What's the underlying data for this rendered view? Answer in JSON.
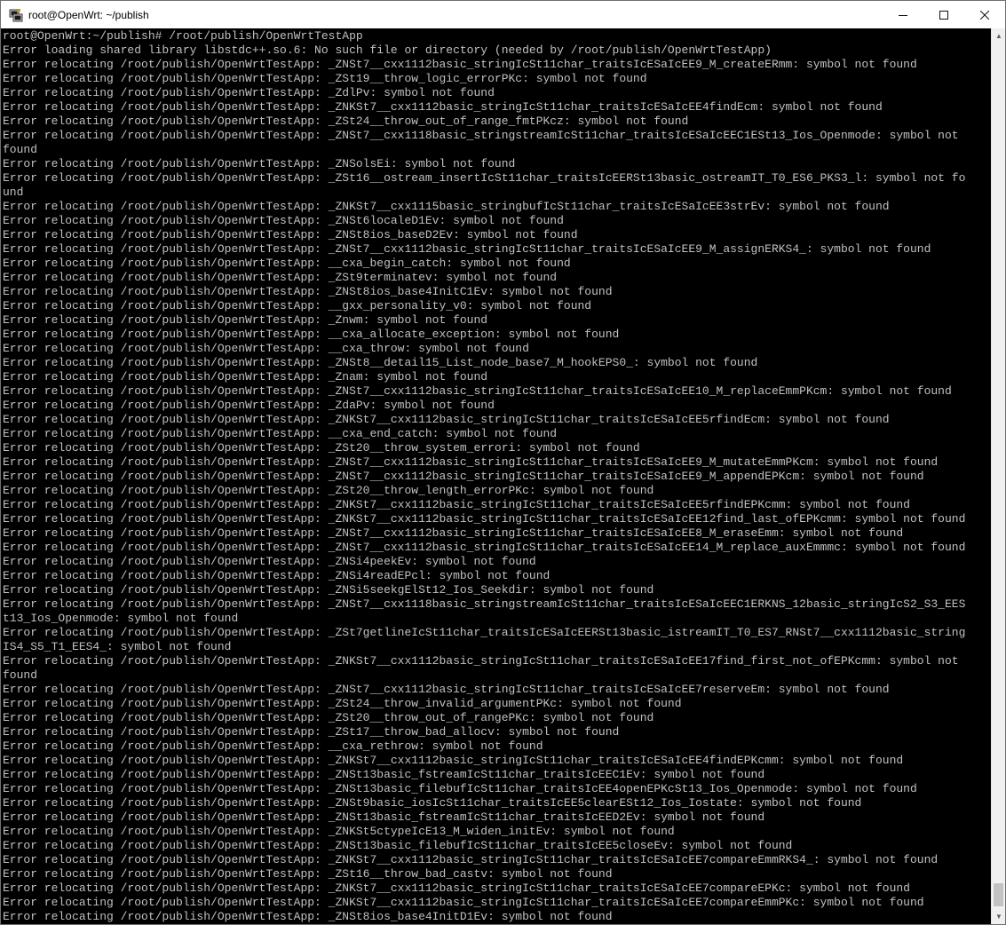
{
  "window": {
    "title": "root@OpenWrt: ~/publish",
    "app_icon": "putty-icon",
    "minimize_icon": "minimize-icon",
    "maximize_icon": "maximize-icon",
    "close_icon": "close-icon"
  },
  "terminal": {
    "background": "#000000",
    "foreground": "#c0c0c0",
    "lines": [
      "root@OpenWrt:~/publish# /root/publish/OpenWrtTestApp",
      "Error loading shared library libstdc++.so.6: No such file or directory (needed by /root/publish/OpenWrtTestApp)",
      "Error relocating /root/publish/OpenWrtTestApp: _ZNSt7__cxx1112basic_stringIcSt11char_traitsIcESaIcEE9_M_createERmm: symbol not found",
      "Error relocating /root/publish/OpenWrtTestApp: _ZSt19__throw_logic_errorPKc: symbol not found",
      "Error relocating /root/publish/OpenWrtTestApp: _ZdlPv: symbol not found",
      "Error relocating /root/publish/OpenWrtTestApp: _ZNKSt7__cxx1112basic_stringIcSt11char_traitsIcESaIcEE4findEcm: symbol not found",
      "Error relocating /root/publish/OpenWrtTestApp: _ZSt24__throw_out_of_range_fmtPKcz: symbol not found",
      "Error relocating /root/publish/OpenWrtTestApp: _ZNSt7__cxx1118basic_stringstreamIcSt11char_traitsIcESaIcEEC1ESt13_Ios_Openmode: symbol not",
      "found",
      "Error relocating /root/publish/OpenWrtTestApp: _ZNSolsEi: symbol not found",
      "Error relocating /root/publish/OpenWrtTestApp: _ZSt16__ostream_insertIcSt11char_traitsIcEERSt13basic_ostreamIT_T0_ES6_PKS3_l: symbol not fo",
      "und",
      "Error relocating /root/publish/OpenWrtTestApp: _ZNKSt7__cxx1115basic_stringbufIcSt11char_traitsIcESaIcEE3strEv: symbol not found",
      "Error relocating /root/publish/OpenWrtTestApp: _ZNSt6localeD1Ev: symbol not found",
      "Error relocating /root/publish/OpenWrtTestApp: _ZNSt8ios_baseD2Ev: symbol not found",
      "Error relocating /root/publish/OpenWrtTestApp: _ZNSt7__cxx1112basic_stringIcSt11char_traitsIcESaIcEE9_M_assignERKS4_: symbol not found",
      "Error relocating /root/publish/OpenWrtTestApp: __cxa_begin_catch: symbol not found",
      "Error relocating /root/publish/OpenWrtTestApp: _ZSt9terminatev: symbol not found",
      "Error relocating /root/publish/OpenWrtTestApp: _ZNSt8ios_base4InitC1Ev: symbol not found",
      "Error relocating /root/publish/OpenWrtTestApp: __gxx_personality_v0: symbol not found",
      "Error relocating /root/publish/OpenWrtTestApp: _Znwm: symbol not found",
      "Error relocating /root/publish/OpenWrtTestApp: __cxa_allocate_exception: symbol not found",
      "Error relocating /root/publish/OpenWrtTestApp: __cxa_throw: symbol not found",
      "Error relocating /root/publish/OpenWrtTestApp: _ZNSt8__detail15_List_node_base7_M_hookEPS0_: symbol not found",
      "Error relocating /root/publish/OpenWrtTestApp: _Znam: symbol not found",
      "Error relocating /root/publish/OpenWrtTestApp: _ZNSt7__cxx1112basic_stringIcSt11char_traitsIcESaIcEE10_M_replaceEmmPKcm: symbol not found",
      "Error relocating /root/publish/OpenWrtTestApp: _ZdaPv: symbol not found",
      "Error relocating /root/publish/OpenWrtTestApp: _ZNKSt7__cxx1112basic_stringIcSt11char_traitsIcESaIcEE5rfindEcm: symbol not found",
      "Error relocating /root/publish/OpenWrtTestApp: __cxa_end_catch: symbol not found",
      "Error relocating /root/publish/OpenWrtTestApp: _ZSt20__throw_system_errori: symbol not found",
      "Error relocating /root/publish/OpenWrtTestApp: _ZNSt7__cxx1112basic_stringIcSt11char_traitsIcESaIcEE9_M_mutateEmmPKcm: symbol not found",
      "Error relocating /root/publish/OpenWrtTestApp: _ZNSt7__cxx1112basic_stringIcSt11char_traitsIcESaIcEE9_M_appendEPKcm: symbol not found",
      "Error relocating /root/publish/OpenWrtTestApp: _ZSt20__throw_length_errorPKc: symbol not found",
      "Error relocating /root/publish/OpenWrtTestApp: _ZNKSt7__cxx1112basic_stringIcSt11char_traitsIcESaIcEE5rfindEPKcmm: symbol not found",
      "Error relocating /root/publish/OpenWrtTestApp: _ZNKSt7__cxx1112basic_stringIcSt11char_traitsIcESaIcEE12find_last_ofEPKcmm: symbol not found",
      "Error relocating /root/publish/OpenWrtTestApp: _ZNSt7__cxx1112basic_stringIcSt11char_traitsIcESaIcEE8_M_eraseEmm: symbol not found",
      "Error relocating /root/publish/OpenWrtTestApp: _ZNSt7__cxx1112basic_stringIcSt11char_traitsIcESaIcEE14_M_replace_auxEmmmc: symbol not found",
      "Error relocating /root/publish/OpenWrtTestApp: _ZNSi4peekEv: symbol not found",
      "Error relocating /root/publish/OpenWrtTestApp: _ZNSi4readEPcl: symbol not found",
      "Error relocating /root/publish/OpenWrtTestApp: _ZNSi5seekgElSt12_Ios_Seekdir: symbol not found",
      "Error relocating /root/publish/OpenWrtTestApp: _ZNSt7__cxx1118basic_stringstreamIcSt11char_traitsIcESaIcEEC1ERKNS_12basic_stringIcS2_S3_EES",
      "t13_Ios_Openmode: symbol not found",
      "Error relocating /root/publish/OpenWrtTestApp: _ZSt7getlineIcSt11char_traitsIcESaIcEERSt13basic_istreamIT_T0_ES7_RNSt7__cxx1112basic_string",
      "IS4_S5_T1_EES4_: symbol not found",
      "Error relocating /root/publish/OpenWrtTestApp: _ZNKSt7__cxx1112basic_stringIcSt11char_traitsIcESaIcEE17find_first_not_ofEPKcmm: symbol not",
      "found",
      "Error relocating /root/publish/OpenWrtTestApp: _ZNSt7__cxx1112basic_stringIcSt11char_traitsIcESaIcEE7reserveEm: symbol not found",
      "Error relocating /root/publish/OpenWrtTestApp: _ZSt24__throw_invalid_argumentPKc: symbol not found",
      "Error relocating /root/publish/OpenWrtTestApp: _ZSt20__throw_out_of_rangePKc: symbol not found",
      "Error relocating /root/publish/OpenWrtTestApp: _ZSt17__throw_bad_allocv: symbol not found",
      "Error relocating /root/publish/OpenWrtTestApp: __cxa_rethrow: symbol not found",
      "Error relocating /root/publish/OpenWrtTestApp: _ZNKSt7__cxx1112basic_stringIcSt11char_traitsIcESaIcEE4findEPKcmm: symbol not found",
      "Error relocating /root/publish/OpenWrtTestApp: _ZNSt13basic_fstreamIcSt11char_traitsIcEEC1Ev: symbol not found",
      "Error relocating /root/publish/OpenWrtTestApp: _ZNSt13basic_filebufIcSt11char_traitsIcEE4openEPKcSt13_Ios_Openmode: symbol not found",
      "Error relocating /root/publish/OpenWrtTestApp: _ZNSt9basic_iosIcSt11char_traitsIcEE5clearESt12_Ios_Iostate: symbol not found",
      "Error relocating /root/publish/OpenWrtTestApp: _ZNSt13basic_fstreamIcSt11char_traitsIcEED2Ev: symbol not found",
      "Error relocating /root/publish/OpenWrtTestApp: _ZNKSt5ctypeIcE13_M_widen_initEv: symbol not found",
      "Error relocating /root/publish/OpenWrtTestApp: _ZNSt13basic_filebufIcSt11char_traitsIcEE5closeEv: symbol not found",
      "Error relocating /root/publish/OpenWrtTestApp: _ZNKSt7__cxx1112basic_stringIcSt11char_traitsIcESaIcEE7compareEmmRKS4_: symbol not found",
      "Error relocating /root/publish/OpenWrtTestApp: _ZSt16__throw_bad_castv: symbol not found",
      "Error relocating /root/publish/OpenWrtTestApp: _ZNKSt7__cxx1112basic_stringIcSt11char_traitsIcESaIcEE7compareEPKc: symbol not found",
      "Error relocating /root/publish/OpenWrtTestApp: _ZNKSt7__cxx1112basic_stringIcSt11char_traitsIcESaIcEE7compareEmmPKc: symbol not found",
      "Error relocating /root/publish/OpenWrtTestApp: _ZNSt8ios_base4InitD1Ev: symbol not found"
    ]
  }
}
